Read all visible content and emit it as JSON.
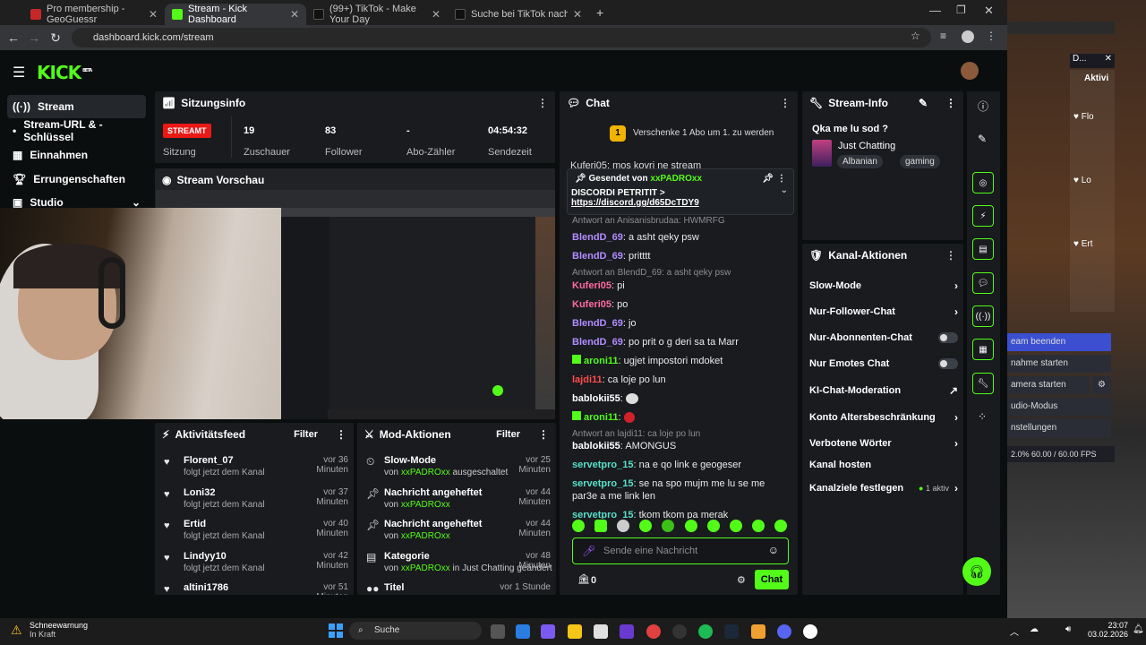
{
  "browser": {
    "tabs": [
      {
        "label": "Pro membership - GeoGuessr",
        "color": "#c62828"
      },
      {
        "label": "Stream - Kick Dashboard",
        "color": "#53fc18"
      },
      {
        "label": "(99+) TikTok - Make Your Day",
        "color": "#111111"
      },
      {
        "label": "Suche bei TikTok nach \"qka ka...",
        "color": "#111111"
      }
    ],
    "url": "dashboard.kick.com/stream"
  },
  "kick": {
    "logo": "KICK",
    "logo_badge": "BETA",
    "nav": [
      {
        "label": "Stream",
        "icon": "broadcast-icon"
      },
      {
        "label": "Stream-URL & -Schlüssel",
        "icon": "key-icon"
      },
      {
        "label": "Einnahmen",
        "icon": "chart-icon"
      },
      {
        "label": "Errungenschaften",
        "icon": "trophy-icon"
      },
      {
        "label": "Studio",
        "icon": "studio-icon"
      }
    ],
    "session": {
      "title": "Sitzungsinfo",
      "live_badge": "STREAMT",
      "session_label": "Sitzung",
      "stats": [
        {
          "value": "19",
          "label": "Zuschauer"
        },
        {
          "value": "83",
          "label": "Follower"
        },
        {
          "value": "-",
          "label": "Abo-Zähler"
        },
        {
          "value": "04:54:32",
          "label": "Sendezeit"
        }
      ]
    },
    "preview": {
      "title": "Stream Vorschau"
    },
    "activity": {
      "title": "Aktivitätsfeed",
      "filter": "Filter",
      "items": [
        {
          "name": "Florent_07",
          "sub": "folgt jetzt dem Kanal",
          "time": "vor 36 Minuten"
        },
        {
          "name": "Loni32",
          "sub": "folgt jetzt dem Kanal",
          "time": "vor 37 Minuten"
        },
        {
          "name": "Ertid",
          "sub": "folgt jetzt dem Kanal",
          "time": "vor 40 Minuten"
        },
        {
          "name": "Lindyy10",
          "sub": "folgt jetzt dem Kanal",
          "time": "vor 42 Minuten"
        },
        {
          "name": "altini1786",
          "sub": "",
          "time": "vor 51 Minuten"
        }
      ]
    },
    "mod": {
      "title": "Mod-Aktionen",
      "filter": "Filter",
      "items": [
        {
          "name": "Slow-Mode",
          "by": "von",
          "user": "xxPADROxx",
          "action": "ausgeschaltet",
          "time": "vor 25 Minuten"
        },
        {
          "name": "Nachricht angeheftet",
          "by": "von",
          "user": "xxPADROxx",
          "action": "",
          "time": "vor 44 Minuten"
        },
        {
          "name": "Nachricht angeheftet",
          "by": "von",
          "user": "xxPADROxx",
          "action": "",
          "time": "vor 44 Minuten"
        },
        {
          "name": "Kategorie",
          "by": "von",
          "user": "xxPADROxx",
          "action": "in Just Chatting geändert",
          "time": "vor 48 Minuten"
        },
        {
          "name": "Titel",
          "by": "",
          "user": "",
          "action": "",
          "time": "vor 1 Stunde"
        }
      ]
    },
    "chat": {
      "title": "Chat",
      "gift_banner": "Verschenke 1 Abo um 1. zu werden",
      "pinned_by_label": "Gesendet von",
      "pinned_by": "xxPADROxx",
      "pinned_text": "DISCORDI PETRITIT >",
      "pinned_link": "https://discord.gg/d65DcTDY9",
      "top_line": "Kuferi05: mos kovri ne stream",
      "messages": [
        {
          "reply": "Antwort an Anisanisbrudaa: HWMRFG"
        },
        {
          "user": "BlendD_69",
          "color": "#b18cff",
          "text": "a asht qeky psw"
        },
        {
          "user": "BlendD_69",
          "color": "#b18cff",
          "text": "pritttt"
        },
        {
          "reply": "Antwort an BlendD_69: a asht qeky psw"
        },
        {
          "user": "Kuferi05",
          "color": "#ff6b9d",
          "text": "pi"
        },
        {
          "user": "Kuferi05",
          "color": "#ff6b9d",
          "text": "po"
        },
        {
          "user": "BlendD_69",
          "color": "#b18cff",
          "text": "jo"
        },
        {
          "user": "BlendD_69",
          "color": "#b18cff",
          "text": "po prit o g deri sa ta Marr"
        },
        {
          "user": "aroni11",
          "color": "#53fc18",
          "text": "ugjet impostori mdoket"
        },
        {
          "user": "lajdi11",
          "color": "#ff4d4d",
          "text": "ca loje po lun"
        },
        {
          "user": "bablokii55",
          "color": "#ffffff",
          "text": ""
        },
        {
          "user": "aroni11",
          "color": "#53fc18",
          "text": ""
        },
        {
          "reply": "Antwort an lajdi11: ca loje po lun"
        },
        {
          "user": "bablokii55",
          "color": "#ffffff",
          "text": "AMONGUS"
        },
        {
          "user": "servetpro_15",
          "color": "#58e0c8",
          "text": "na e qo link e geogeser"
        },
        {
          "user": "servetpro_15",
          "color": "#58e0c8",
          "text": "se na spo mujm me lu se me par3e a me link len"
        },
        {
          "user": "servetpro_15",
          "color": "#58e0c8",
          "text": "tkom tkom pa merak"
        }
      ],
      "input_placeholder": "Sende eine Nachricht",
      "points": "0",
      "send_label": "Chat"
    },
    "stream_info": {
      "title": "Stream-Info",
      "stream_title": "Qka me lu sod ?",
      "category": "Just Chatting",
      "tags": [
        "Albanian",
        "gaming"
      ]
    },
    "channel_actions": {
      "title": "Kanal-Aktionen",
      "items": [
        {
          "label": "Slow-Mode",
          "type": "chevron"
        },
        {
          "label": "Nur-Follower-Chat",
          "type": "chevron"
        },
        {
          "label": "Nur-Abonnenten-Chat",
          "type": "toggle"
        },
        {
          "label": "Nur Emotes Chat",
          "type": "toggle"
        },
        {
          "label": "KI-Chat-Moderation",
          "type": "external"
        },
        {
          "label": "Konto Altersbeschränkung",
          "type": "chevron"
        },
        {
          "label": "Verbotene Wörter",
          "type": "chevron"
        },
        {
          "label": "Kanal hosten",
          "type": "none"
        },
        {
          "label": "Kanalziele festlegen",
          "type": "chevron",
          "badge": "1 aktiv"
        }
      ]
    }
  },
  "obs": {
    "rows": [
      "eam beenden",
      "nahme starten",
      "amera starten",
      "udio-Modus",
      "nstellungen"
    ],
    "stats": "2.0%   60.00 / 60.00 FPS",
    "title": "D...",
    "panel": "Aktivi",
    "feed_labels": [
      "Flo",
      "Lo",
      "Ert"
    ]
  },
  "taskbar": {
    "weather_title": "Schneewarnung",
    "weather_sub": "In Kraft",
    "search": "Suche",
    "time": "23:07",
    "date": "03.02.2026"
  }
}
